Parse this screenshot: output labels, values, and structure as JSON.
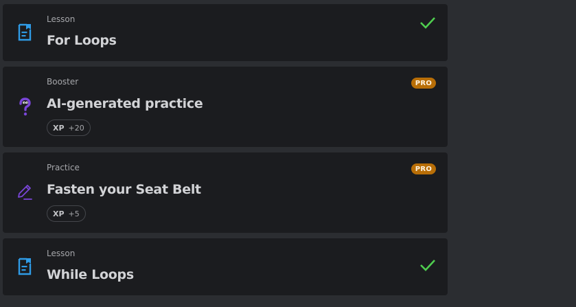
{
  "items": [
    {
      "kind": "Lesson",
      "title": "For Loops",
      "icon": "lesson-icon",
      "completed": true
    },
    {
      "kind": "Booster",
      "title": "AI-generated practice",
      "icon": "question-icon",
      "badge": "PRO",
      "xp_label": "XP",
      "xp_value": "+20"
    },
    {
      "kind": "Practice",
      "title": "Fasten your Seat Belt",
      "icon": "pencil-icon",
      "badge": "PRO",
      "xp_label": "XP",
      "xp_value": "+5"
    },
    {
      "kind": "Lesson",
      "title": "While Loops",
      "icon": "lesson-icon",
      "completed": true
    }
  ],
  "colors": {
    "page_bg": "#2b2d31",
    "card_bg": "#1b1c1f",
    "lesson_icon": "#2f9be6",
    "practice_icon": "#7a46d9",
    "check": "#4fce4f",
    "pro_badge": "#b86e07"
  }
}
